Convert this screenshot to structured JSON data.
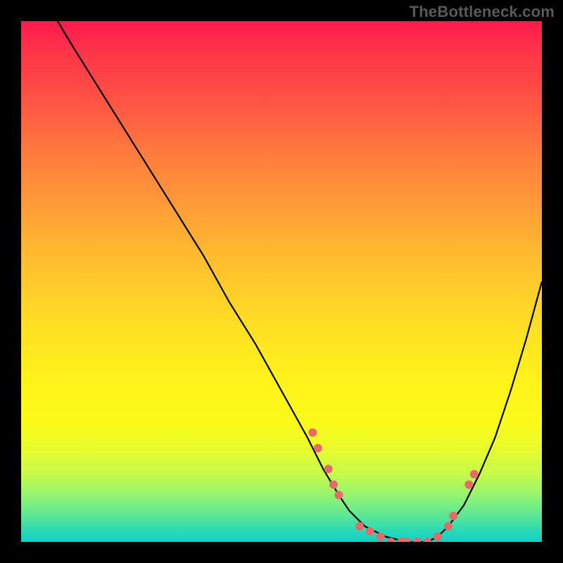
{
  "watermark": "TheBottleneck.com",
  "chart_data": {
    "type": "line",
    "title": "",
    "xlabel": "",
    "ylabel": "",
    "xlim": [
      0,
      100
    ],
    "ylim": [
      0,
      100
    ],
    "grid": false,
    "legend": false,
    "background_gradient": {
      "direction": "vertical",
      "stops": [
        {
          "pos": 0.0,
          "color": "#ff1a4d"
        },
        {
          "pos": 0.25,
          "color": "#ff7a3e"
        },
        {
          "pos": 0.5,
          "color": "#ffcc28"
        },
        {
          "pos": 0.7,
          "color": "#fff41a"
        },
        {
          "pos": 0.88,
          "color": "#a8f55f"
        },
        {
          "pos": 1.0,
          "color": "#0fd0c9"
        }
      ]
    },
    "series": [
      {
        "name": "bottleneck-curve",
        "color": "#000000",
        "x": [
          7,
          10,
          15,
          20,
          25,
          30,
          35,
          40,
          45,
          50,
          55,
          58,
          61,
          63,
          66,
          70,
          74,
          78,
          80,
          82,
          85,
          88,
          91,
          94,
          97,
          100
        ],
        "y": [
          100,
          95,
          87,
          79,
          71,
          63,
          55,
          46,
          38,
          29,
          20,
          14,
          9,
          6,
          3,
          1,
          0,
          0,
          1,
          3,
          7,
          13,
          20,
          29,
          39,
          50
        ]
      }
    ],
    "highlight_points": {
      "name": "marked-dots",
      "color": "#e66a6a",
      "radius": 6,
      "points": [
        {
          "x": 56,
          "y": 21
        },
        {
          "x": 57,
          "y": 18
        },
        {
          "x": 59,
          "y": 14
        },
        {
          "x": 60,
          "y": 11
        },
        {
          "x": 61,
          "y": 9
        },
        {
          "x": 65,
          "y": 3
        },
        {
          "x": 67,
          "y": 2
        },
        {
          "x": 69,
          "y": 1
        },
        {
          "x": 71,
          "y": 0
        },
        {
          "x": 73,
          "y": 0
        },
        {
          "x": 74,
          "y": 0
        },
        {
          "x": 76,
          "y": 0
        },
        {
          "x": 78,
          "y": 0
        },
        {
          "x": 80,
          "y": 1
        },
        {
          "x": 82,
          "y": 3
        },
        {
          "x": 83,
          "y": 5
        },
        {
          "x": 86,
          "y": 11
        },
        {
          "x": 87,
          "y": 13
        }
      ]
    }
  }
}
